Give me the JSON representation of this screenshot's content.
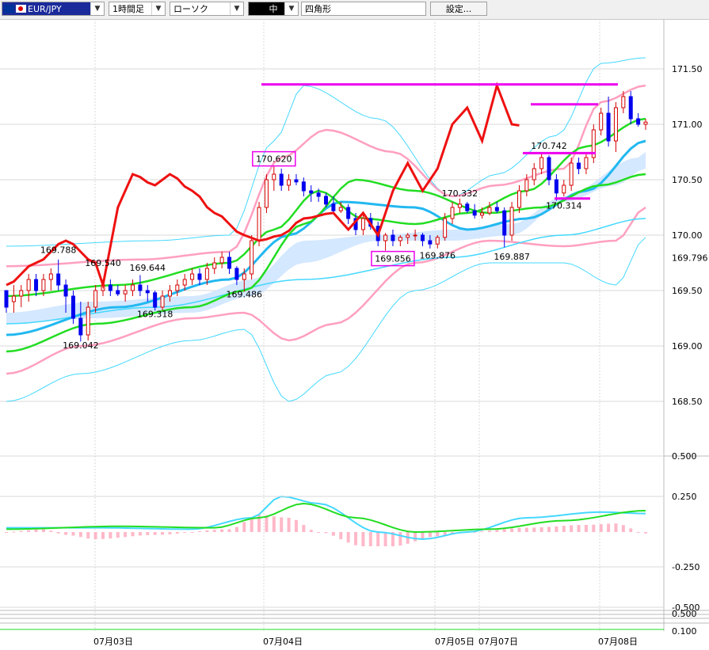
{
  "toolbar": {
    "symbol": "EUR/JPY",
    "timeframe": "1時間足",
    "chart_type": "ローソク",
    "width": "中",
    "shape": "四角形",
    "settings": "設定..."
  },
  "colors": {
    "up": "#d40000",
    "down": "#0000ee",
    "red_line": "#ee1111",
    "green": "#22dd22",
    "cyan": "#44d8ff",
    "pink": "#ff9fbf",
    "cloud": "#cfe6ff",
    "magenta": "#ee00ee",
    "hist": "#ffb8c8",
    "grid": "#d8d8d8"
  },
  "chart_data": {
    "type": "candlestick",
    "price_axis": {
      "labels": [
        "171.50",
        "171.00",
        "170.50",
        "170.00",
        "169.50",
        "169.00",
        "168.50"
      ],
      "values": [
        171.5,
        171.0,
        170.5,
        170.0,
        169.5,
        169.0,
        168.5
      ],
      "current_label": "169.796",
      "ylim": [
        168.2,
        171.98
      ]
    },
    "x_labels": [
      "07月03日",
      "07月04日",
      "07月05日",
      "07月07日",
      "07月08日"
    ],
    "candles_ohlc": [
      [
        169.5,
        169.5,
        169.3,
        169.35
      ],
      [
        169.4,
        169.55,
        169.3,
        169.45
      ],
      [
        169.45,
        169.55,
        169.35,
        169.5
      ],
      [
        169.5,
        169.65,
        169.4,
        169.6
      ],
      [
        169.6,
        169.65,
        169.45,
        169.5
      ],
      [
        169.5,
        169.65,
        169.45,
        169.6
      ],
      [
        169.6,
        169.7,
        169.5,
        169.65
      ],
      [
        169.65,
        169.78,
        169.5,
        169.55
      ],
      [
        169.55,
        169.6,
        169.3,
        169.45
      ],
      [
        169.45,
        169.5,
        169.2,
        169.25
      ],
      [
        169.25,
        169.4,
        169.04,
        169.1
      ],
      [
        169.1,
        169.4,
        169.05,
        169.35
      ],
      [
        169.35,
        169.55,
        169.3,
        169.5
      ],
      [
        169.5,
        169.6,
        169.45,
        169.55
      ],
      [
        169.55,
        169.6,
        169.45,
        169.5
      ],
      [
        169.5,
        169.55,
        169.45,
        169.47
      ],
      [
        169.47,
        169.55,
        169.4,
        169.5
      ],
      [
        169.5,
        169.6,
        169.45,
        169.55
      ],
      [
        169.55,
        169.64,
        169.45,
        169.5
      ],
      [
        169.5,
        169.55,
        169.4,
        169.48
      ],
      [
        169.48,
        169.5,
        169.32,
        169.35
      ],
      [
        169.35,
        169.5,
        169.32,
        169.45
      ],
      [
        169.45,
        169.55,
        169.4,
        169.5
      ],
      [
        169.5,
        169.6,
        169.45,
        169.55
      ],
      [
        169.55,
        169.65,
        169.5,
        169.6
      ],
      [
        169.6,
        169.7,
        169.55,
        169.65
      ],
      [
        169.65,
        169.7,
        169.55,
        169.6
      ],
      [
        169.6,
        169.75,
        169.55,
        169.7
      ],
      [
        169.7,
        169.8,
        169.65,
        169.75
      ],
      [
        169.75,
        169.85,
        169.7,
        169.8
      ],
      [
        169.8,
        169.85,
        169.65,
        169.7
      ],
      [
        169.7,
        169.72,
        169.55,
        169.6
      ],
      [
        169.6,
        169.7,
        169.49,
        169.65
      ],
      [
        169.65,
        170.0,
        169.6,
        169.95
      ],
      [
        169.95,
        170.3,
        169.9,
        170.25
      ],
      [
        170.25,
        170.55,
        170.2,
        170.5
      ],
      [
        170.5,
        170.62,
        170.4,
        170.55
      ],
      [
        170.55,
        170.6,
        170.4,
        170.45
      ],
      [
        170.45,
        170.55,
        170.4,
        170.5
      ],
      [
        170.5,
        170.55,
        170.45,
        170.48
      ],
      [
        170.48,
        170.52,
        170.35,
        170.4
      ],
      [
        170.4,
        170.45,
        170.3,
        170.38
      ],
      [
        170.38,
        170.42,
        170.3,
        170.35
      ],
      [
        170.35,
        170.38,
        170.25,
        170.28
      ],
      [
        170.28,
        170.35,
        170.2,
        170.22
      ],
      [
        170.22,
        170.3,
        170.2,
        170.25
      ],
      [
        170.25,
        170.28,
        170.1,
        170.15
      ],
      [
        170.15,
        170.2,
        170.0,
        170.05
      ],
      [
        170.05,
        170.2,
        170.0,
        170.15
      ],
      [
        170.15,
        170.2,
        170.05,
        170.08
      ],
      [
        170.08,
        170.12,
        169.9,
        169.95
      ],
      [
        169.95,
        170.02,
        169.86,
        170.0
      ],
      [
        170.0,
        170.05,
        169.9,
        169.95
      ],
      [
        169.95,
        170.0,
        169.9,
        169.98
      ],
      [
        169.98,
        170.02,
        169.92,
        170.0
      ],
      [
        170.0,
        170.05,
        169.95,
        170.0
      ],
      [
        170.0,
        170.02,
        169.9,
        169.95
      ],
      [
        169.95,
        170.0,
        169.88,
        169.92
      ],
      [
        169.92,
        170.0,
        169.88,
        169.98
      ],
      [
        169.98,
        170.2,
        169.95,
        170.15
      ],
      [
        170.15,
        170.3,
        170.1,
        170.25
      ],
      [
        170.25,
        170.33,
        170.2,
        170.28
      ],
      [
        170.28,
        170.3,
        170.2,
        170.22
      ],
      [
        170.22,
        170.28,
        170.15,
        170.18
      ],
      [
        170.18,
        170.25,
        170.15,
        170.2
      ],
      [
        170.2,
        170.3,
        170.18,
        170.25
      ],
      [
        170.25,
        170.3,
        170.2,
        170.22
      ],
      [
        170.22,
        170.25,
        169.89,
        170.0
      ],
      [
        170.0,
        170.3,
        169.95,
        170.25
      ],
      [
        170.25,
        170.45,
        170.2,
        170.4
      ],
      [
        170.4,
        170.55,
        170.35,
        170.5
      ],
      [
        170.5,
        170.65,
        170.45,
        170.6
      ],
      [
        170.6,
        170.74,
        170.55,
        170.7
      ],
      [
        170.7,
        170.72,
        170.45,
        170.5
      ],
      [
        170.5,
        170.55,
        170.31,
        170.38
      ],
      [
        170.38,
        170.5,
        170.35,
        170.45
      ],
      [
        170.45,
        170.7,
        170.4,
        170.65
      ],
      [
        170.65,
        170.7,
        170.55,
        170.6
      ],
      [
        170.6,
        170.75,
        170.55,
        170.7
      ],
      [
        170.7,
        171.0,
        170.65,
        170.95
      ],
      [
        170.95,
        171.15,
        170.9,
        171.1
      ],
      [
        171.1,
        171.25,
        170.8,
        170.85
      ],
      [
        170.85,
        171.2,
        170.75,
        171.15
      ],
      [
        171.15,
        171.3,
        171.1,
        171.25
      ],
      [
        171.25,
        171.3,
        171.0,
        171.05
      ],
      [
        171.05,
        171.1,
        170.98,
        171.0
      ],
      [
        171.0,
        171.05,
        170.95,
        171.02
      ]
    ],
    "price_labels": [
      {
        "text": "169.788",
        "price": 169.84,
        "index": 7
      },
      {
        "text": "169.540",
        "price": 169.72,
        "index": 13
      },
      {
        "text": "169.644",
        "price": 169.68,
        "index": 19
      },
      {
        "text": "169.318",
        "price": 169.26,
        "index": 20
      },
      {
        "text": "169.042",
        "price": 168.98,
        "index": 10
      },
      {
        "text": "169.486",
        "price": 169.44,
        "index": 32
      },
      {
        "text": "170.620",
        "price": 170.66,
        "index": 36
      },
      {
        "text": "170.332",
        "price": 170.35,
        "index": 61
      },
      {
        "text": "169.856",
        "price": 169.76,
        "index": 52
      },
      {
        "text": "169.876",
        "price": 169.79,
        "index": 58
      },
      {
        "text": "169.887",
        "price": 169.78,
        "index": 68
      },
      {
        "text": "170.742",
        "price": 170.78,
        "index": 73
      },
      {
        "text": "170.314",
        "price": 170.24,
        "index": 75
      }
    ],
    "macd_axis": {
      "labels": [
        "0.500",
        "0.250",
        "-0.250",
        "-0.500",
        "0.500",
        "0.100"
      ],
      "values": [
        0.5,
        0.25,
        -0.25,
        -0.5
      ]
    }
  }
}
